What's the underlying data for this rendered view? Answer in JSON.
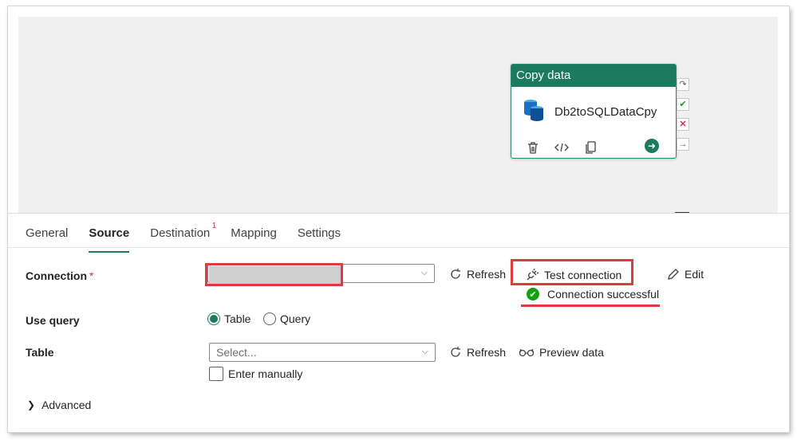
{
  "activity": {
    "type_title": "Copy data",
    "name": "Db2toSQLDataCpy",
    "icons": [
      "database-icon",
      "delete-icon",
      "code-icon",
      "copy-icon",
      "run-arrow-icon"
    ],
    "side_icons": [
      "skip-icon",
      "success-check-icon",
      "fail-x-icon",
      "completion-arrow-icon"
    ]
  },
  "tabs": [
    {
      "label": "General"
    },
    {
      "label": "Source",
      "active": true
    },
    {
      "label": "Destination",
      "badge": "1"
    },
    {
      "label": "Mapping"
    },
    {
      "label": "Settings"
    }
  ],
  "connection": {
    "label": "Connection",
    "required_mark": "*",
    "value": "",
    "refresh_label": "Refresh",
    "test_label": "Test connection",
    "edit_label": "Edit",
    "status": "Connection successful"
  },
  "use_query": {
    "label": "Use query",
    "options": [
      "Table",
      "Query"
    ],
    "selected": "Table"
  },
  "table": {
    "label": "Table",
    "placeholder": "Select...",
    "refresh_label": "Refresh",
    "preview_label": "Preview data",
    "enter_manually": "Enter manually"
  },
  "advanced": {
    "label": "Advanced"
  },
  "colors": {
    "accent": "#1c7a5f",
    "highlight": "#e03a3a",
    "success": "#13a10e"
  }
}
